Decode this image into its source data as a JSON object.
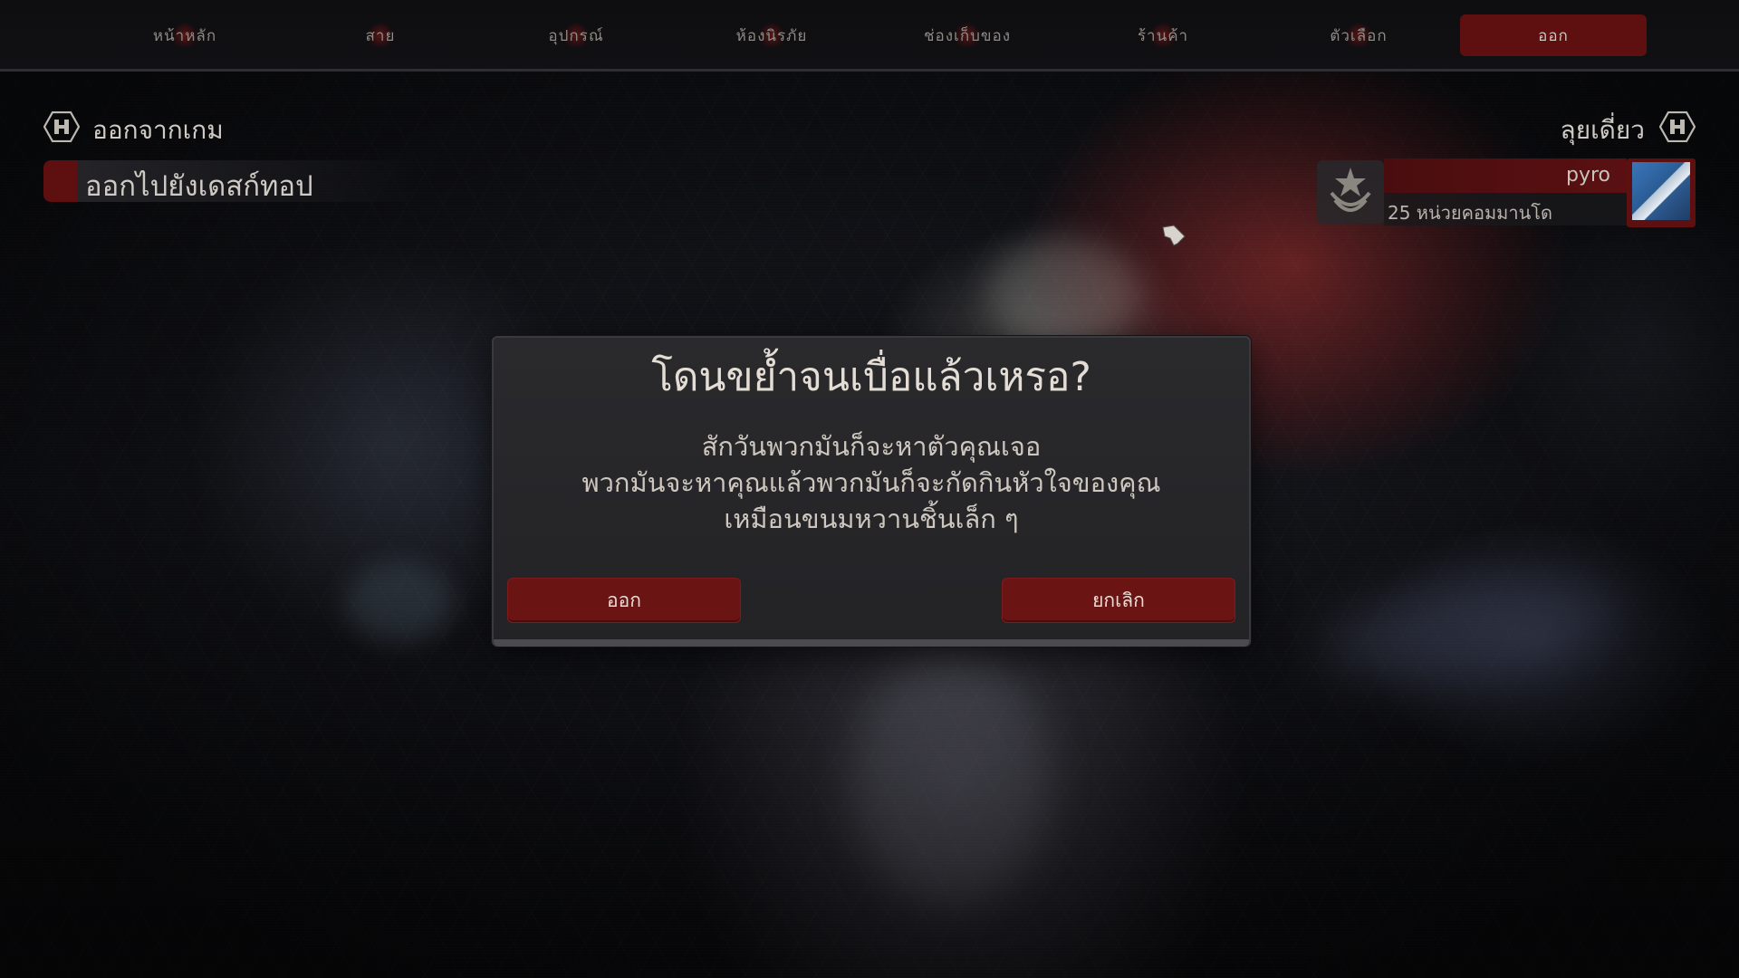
{
  "nav": {
    "items": [
      {
        "label": "หน้าหลัก",
        "icon": "nav-emblem-icon"
      },
      {
        "label": "สาย",
        "icon": "nav-emblem-icon"
      },
      {
        "label": "อุปกรณ์",
        "icon": "nav-emblem-icon"
      },
      {
        "label": "ห้องนิรภัย",
        "icon": "nav-emblem-icon"
      },
      {
        "label": "ช่องเก็บของ",
        "icon": "nav-emblem-icon"
      },
      {
        "label": "ร้านค้า",
        "icon": "nav-emblem-icon"
      },
      {
        "label": "ตัวเลือก",
        "icon": "nav-emblem-icon"
      },
      {
        "label": "ออก",
        "active": true
      }
    ]
  },
  "header": {
    "left_label": "ออกจากเกม",
    "left_button": "ออกไปยังเดสก์ทอป",
    "right_label": "ลุยเดี่ยว"
  },
  "profile": {
    "name": "pyro",
    "credits": "25 หน่วยคอมมานโด",
    "rank_icon": "rank-star-icon"
  },
  "modal": {
    "title": "โดนขย้ำจนเบื่อแล้วเหรอ?",
    "lines": [
      "สักวันพวกมันก็จะหาตัวคุณเจอ",
      "พวกมันจะหาคุณแล้วพวกมันก็จะกัดกินหัวใจของคุณ",
      "เหมือนขนมหวานชิ้นเล็ก ๆ"
    ],
    "confirm_label": "ออก",
    "cancel_label": "ยกเลิก"
  },
  "colors": {
    "accent_red": "#6b1414",
    "modal_bg": "#2a2a2d",
    "text": "#d9d4cc"
  }
}
